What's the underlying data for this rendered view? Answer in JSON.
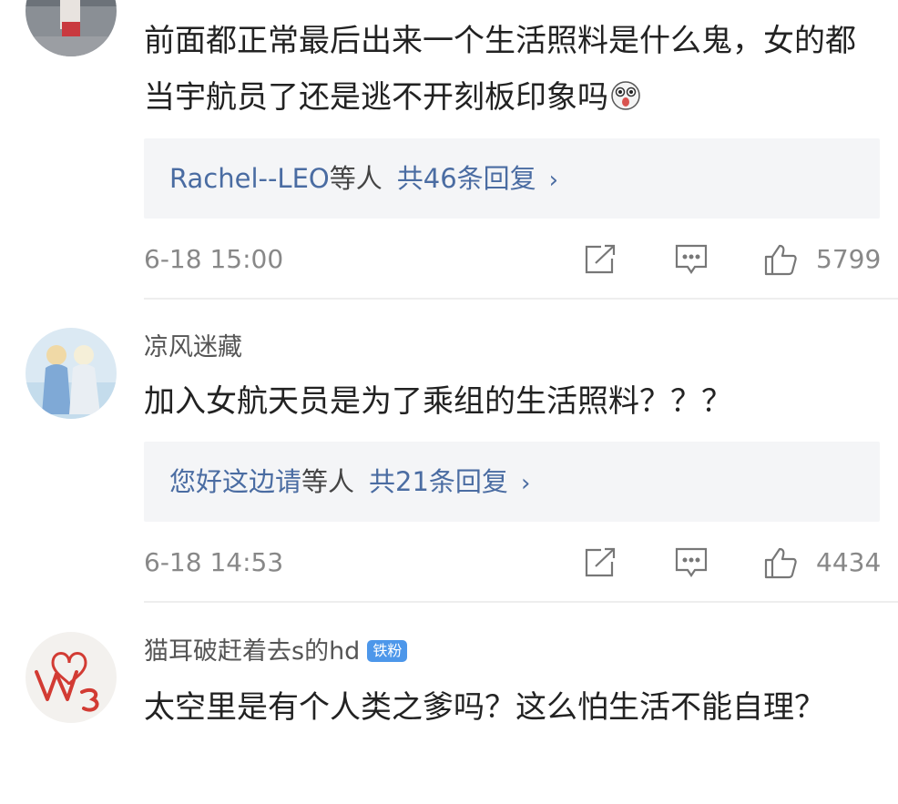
{
  "comments": [
    {
      "username": "",
      "content": "前面都正常最后出来一个生活照料是什么鬼，女的都当宇航员了还是逃不开刻板印象吗",
      "reply_names": "Rachel--LEO",
      "reply_suffix": "等人",
      "reply_count": "共46条回复",
      "time": "6-18 15:00",
      "likes": "5799"
    },
    {
      "username": "凉风迷藏",
      "content": "加入女航天员是为了乘组的生活照料？？？",
      "reply_names": "您好这边请",
      "reply_suffix": "等人",
      "reply_count": "共21条回复",
      "time": "6-18 14:53",
      "likes": "4434"
    },
    {
      "username": "猫耳破赶着去s的hd",
      "badge": "铁粉",
      "content": "太空里是有个人类之爹吗？这么怕生活不能自理？"
    }
  ],
  "icons": {
    "chevron": "›",
    "share": "share-icon",
    "comment": "comment-icon",
    "like": "thumbs-up-icon"
  },
  "colors": {
    "link": "#4a6ca2",
    "badge": "#4d97ea",
    "reply_bg": "#f4f5f7"
  }
}
